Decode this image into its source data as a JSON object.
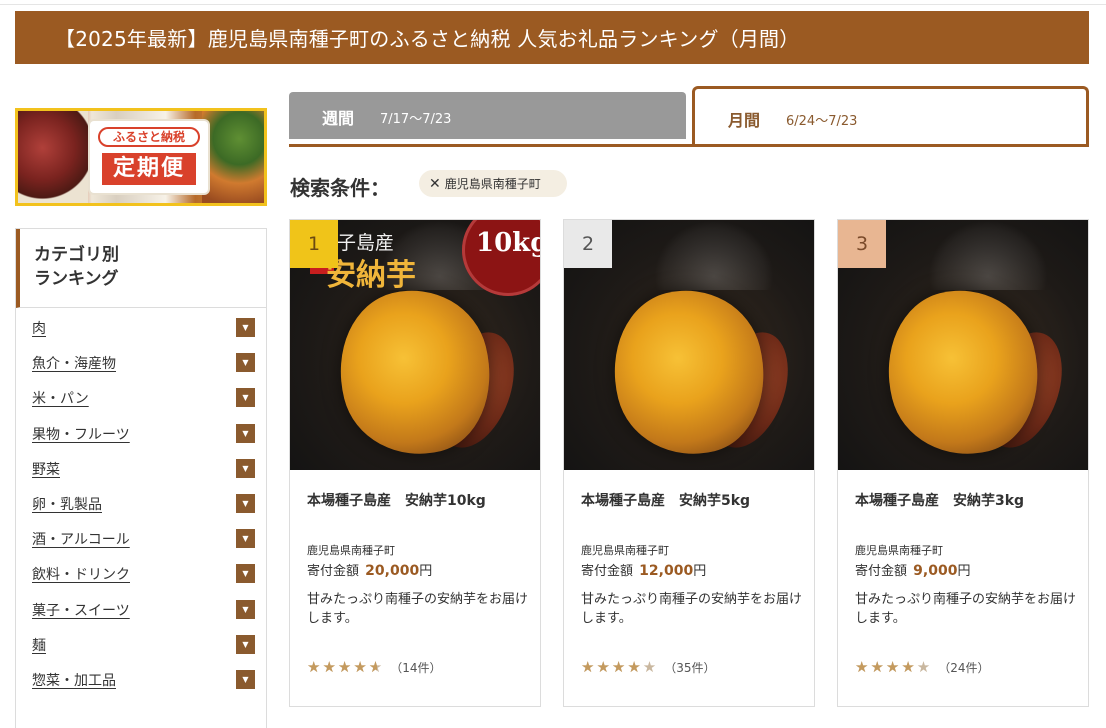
{
  "page": {
    "header_title": "【2025年最新】鹿児島県南種子町のふるさと納税 人気お礼品ランキング（月間）"
  },
  "banner": {
    "subtitle": "ふるさと納税",
    "title": "定期便"
  },
  "category": {
    "heading_line1": "カテゴリ別",
    "heading_line2": "ランキング",
    "items": [
      {
        "label": "肉"
      },
      {
        "label": "魚介・海産物"
      },
      {
        "label": "米・パン"
      },
      {
        "label": "果物・フルーツ"
      },
      {
        "label": "野菜"
      },
      {
        "label": "卵・乳製品"
      },
      {
        "label": "酒・アルコール"
      },
      {
        "label": "飲料・ドリンク"
      },
      {
        "label": "菓子・スイーツ"
      },
      {
        "label": "麺"
      },
      {
        "label": "惣菜・加工品"
      }
    ]
  },
  "tabs": {
    "weekly": {
      "label": "週間",
      "dates": "7/17〜7/23"
    },
    "monthly": {
      "label": "月間",
      "dates": "6/24〜7/23"
    }
  },
  "filter": {
    "label": "検索条件：",
    "chip": "鹿児島県南種子町"
  },
  "products": [
    {
      "rank": "1",
      "title": "本場種子島産　安納芋10kg",
      "town": "鹿児島県南種子町",
      "price_label": "寄付金額",
      "price": "20,000",
      "yen": "円",
      "description": "甘みたっぷり南種子の安納芋をお届けします。",
      "rating": 4.5,
      "review_count": "（14件）",
      "image_text1": "種子島産",
      "image_text2": "安納芋",
      "image_badge": "10kg"
    },
    {
      "rank": "2",
      "title": "本場種子島産　安納芋5kg",
      "town": "鹿児島県南種子町",
      "price_label": "寄付金額",
      "price": "12,000",
      "yen": "円",
      "description": "甘みたっぷり南種子の安納芋をお届けします。",
      "rating": 4.0,
      "review_count": "（35件）"
    },
    {
      "rank": "3",
      "title": "本場種子島産　安納芋3kg",
      "town": "鹿児島県南種子町",
      "price_label": "寄付金額",
      "price": "9,000",
      "yen": "円",
      "description": "甘みたっぷり南種子の安納芋をお届けします。",
      "rating": 4.0,
      "review_count": "（24件）"
    }
  ],
  "colors": {
    "brand_brown": "#9b5a22",
    "rank1": "#f0c419",
    "rank2": "#e9e9e9",
    "rank3": "#e8b692"
  }
}
